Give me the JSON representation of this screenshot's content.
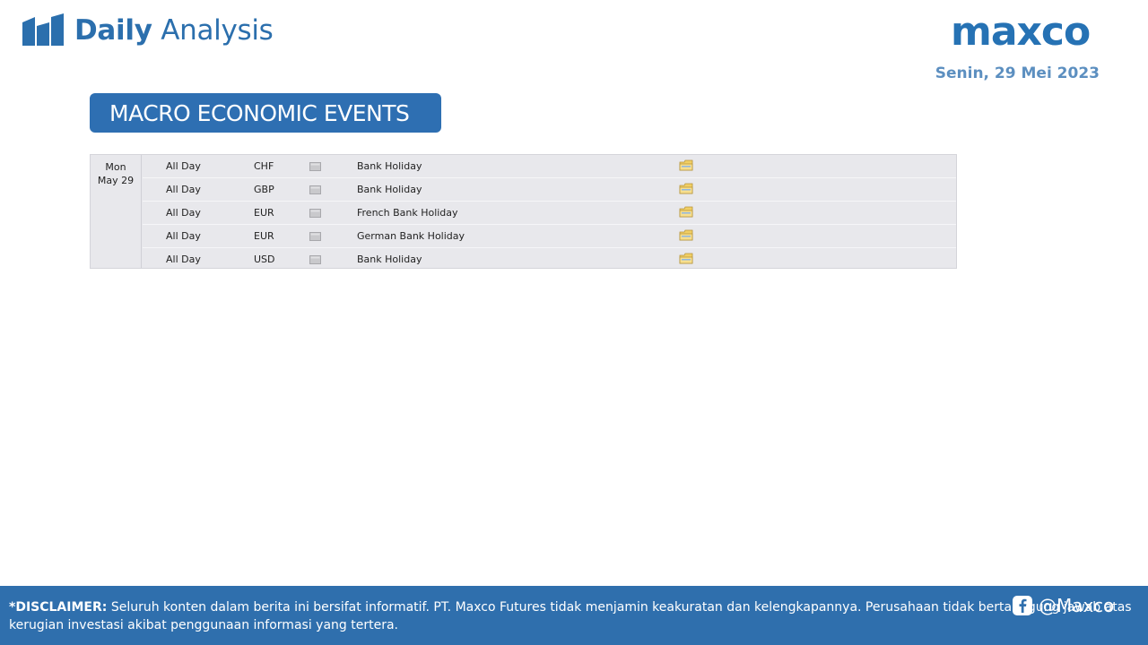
{
  "header": {
    "title_bold": "Daily",
    "title_light": "Analysis",
    "logo": "maxco",
    "date": "Senin, 29 Mei 2023"
  },
  "section": {
    "title": "MACRO ECONOMIC EVENTS"
  },
  "calendar": {
    "day": "Mon",
    "date": "May 29",
    "rows": [
      {
        "time": "All Day",
        "currency": "CHF",
        "event": "Bank Holiday"
      },
      {
        "time": "All Day",
        "currency": "GBP",
        "event": "Bank Holiday"
      },
      {
        "time": "All Day",
        "currency": "EUR",
        "event": "French Bank Holiday"
      },
      {
        "time": "All Day",
        "currency": "EUR",
        "event": "German Bank Holiday"
      },
      {
        "time": "All Day",
        "currency": "USD",
        "event": "Bank Holiday"
      }
    ]
  },
  "footer": {
    "disclaimer_label": "*DISCLAIMER:",
    "disclaimer_text": "Seluruh konten dalam berita ini bersifat informatif. PT. Maxco Futures tidak menjamin keakuratan dan kelengkapannya. Perusahaan tidak bertanggung jawab atas kerugian investasi akibat penggunaan informasi yang tertera.",
    "social_handle": "@Maxco"
  },
  "colors": {
    "brand_blue": "#2b6fad",
    "footer_blue": "#2f6fad",
    "table_bg": "#e8e8ec",
    "date_blue": "#5c8fc0"
  },
  "icons": {
    "brand": "bar-chart-icon",
    "impact": "impact-gray-icon",
    "detail": "folder-icon",
    "social": "facebook-icon"
  }
}
